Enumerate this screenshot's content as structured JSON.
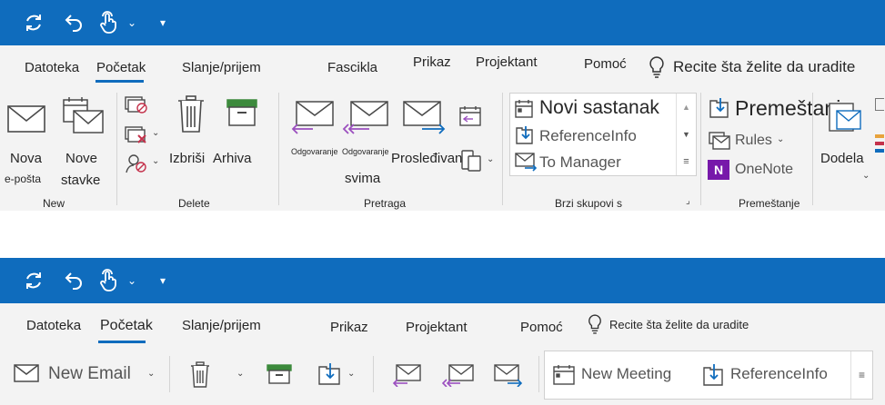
{
  "top": {
    "qat": {
      "sync_icon": "sync-icon",
      "undo_icon": "undo-icon",
      "touch_icon": "touch-mode-icon",
      "caret": "⌄",
      "customize": "▾"
    },
    "tabs": [
      {
        "label": "Datoteka"
      },
      {
        "label": "Početak"
      },
      {
        "label": "Slanje/prijem"
      },
      {
        "label": "Fascikla"
      },
      {
        "label": "Prikaz"
      },
      {
        "label": "Projektant"
      },
      {
        "label": "Pomoć"
      }
    ],
    "tell_me": "Recite šta želite da uradite",
    "new_group": {
      "new_email_line1": "Nova",
      "new_email_line2": "e-pošta",
      "new_items_line1": "Nove",
      "new_items_line2": "stavke",
      "label": "New"
    },
    "delete_group": {
      "delete": "Izbriši",
      "archive": "Arhiva",
      "label": "Delete"
    },
    "respond_group": {
      "reply": "Odgovaranje",
      "reply_all_line1": "Odgovaranje",
      "reply_all_line2": "svima",
      "forward": "Prosleđivanje",
      "label": "Pretraga"
    },
    "quick_steps": {
      "items": [
        "Novi sastanak",
        "ReferenceInfo",
        "To Manager"
      ],
      "label": "Brzi skupovi s"
    },
    "move_group": {
      "move": "Premeštanje",
      "rules": "Rules",
      "onenote": "OneNote",
      "label": "Premeštanje"
    },
    "assign": "Dodela"
  },
  "bottom": {
    "tabs": [
      {
        "label": "Datoteka"
      },
      {
        "label": "Početak"
      },
      {
        "label": "Slanje/prijem"
      },
      {
        "label": "Prikaz"
      },
      {
        "label": "Projektant"
      },
      {
        "label": "Pomoć"
      }
    ],
    "tell_me": "Recite šta želite da uradite",
    "new_email": "New Email",
    "quick_steps": [
      "New Meeting",
      "ReferenceInfo"
    ]
  },
  "colors": {
    "accent": "#0f6cbd",
    "ribbon": "#f3f3f3",
    "archive_green": "#3c8a3c",
    "delete_red": "#c4314b",
    "onenote_purple": "#7719aa",
    "reply_purple": "#9b4fbf"
  }
}
